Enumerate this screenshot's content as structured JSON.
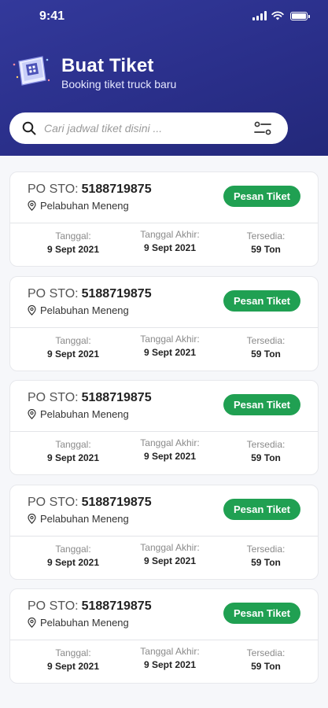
{
  "status_bar": {
    "time": "9:41"
  },
  "header": {
    "title": "Buat Tiket",
    "subtitle": "Booking tiket truck baru",
    "hero_icon": "ticket-icon"
  },
  "search": {
    "placeholder": "Cari jadwal tiket disini ...",
    "filter_icon": "sliders-icon"
  },
  "cards": [
    {
      "po_label": "PO STO:",
      "po_number": "5188719875",
      "location": "Pelabuhan Meneng",
      "button": "Pesan Tiket",
      "tanggal_label": "Tanggal:",
      "tanggal": "9 Sept 2021",
      "tanggal_akhir_label": "Tanggal Akhir:",
      "tanggal_akhir": "9 Sept 2021",
      "tersedia_label": "Tersedia:",
      "tersedia": "59 Ton"
    },
    {
      "po_label": "PO STO:",
      "po_number": "5188719875",
      "location": "Pelabuhan Meneng",
      "button": "Pesan Tiket",
      "tanggal_label": "Tanggal:",
      "tanggal": "9 Sept 2021",
      "tanggal_akhir_label": "Tanggal Akhir:",
      "tanggal_akhir": "9 Sept 2021",
      "tersedia_label": "Tersedia:",
      "tersedia": "59 Ton"
    },
    {
      "po_label": "PO STO:",
      "po_number": "5188719875",
      "location": "Pelabuhan Meneng",
      "button": "Pesan Tiket",
      "tanggal_label": "Tanggal:",
      "tanggal": "9 Sept 2021",
      "tanggal_akhir_label": "Tanggal Akhir:",
      "tanggal_akhir": "9 Sept 2021",
      "tersedia_label": "Tersedia:",
      "tersedia": "59 Ton"
    },
    {
      "po_label": "PO STO:",
      "po_number": "5188719875",
      "location": "Pelabuhan Meneng",
      "button": "Pesan Tiket",
      "tanggal_label": "Tanggal:",
      "tanggal": "9 Sept 2021",
      "tanggal_akhir_label": "Tanggal Akhir:",
      "tanggal_akhir": "9 Sept 2021",
      "tersedia_label": "Tersedia:",
      "tersedia": "59 Ton"
    },
    {
      "po_label": "PO STO:",
      "po_number": "5188719875",
      "location": "Pelabuhan Meneng",
      "button": "Pesan Tiket",
      "tanggal_label": "Tanggal:",
      "tanggal": "9 Sept 2021",
      "tanggal_akhir_label": "Tanggal Akhir:",
      "tanggal_akhir": "9 Sept 2021",
      "tersedia_label": "Tersedia:",
      "tersedia": "59 Ton"
    }
  ],
  "colors": {
    "header": "#2a2f8a",
    "button": "#20a052",
    "background": "#f6f7fa"
  }
}
